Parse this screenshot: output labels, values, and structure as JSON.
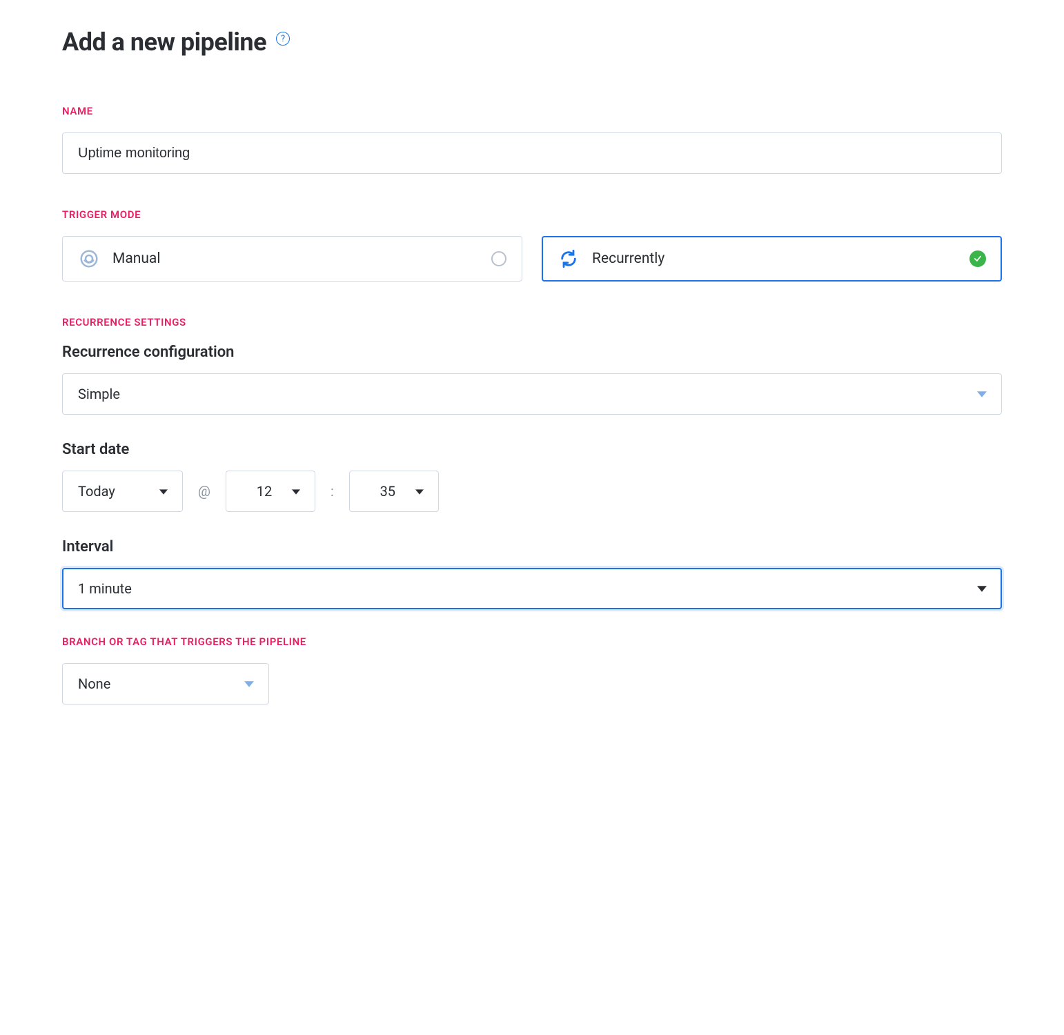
{
  "header": {
    "title": "Add a new pipeline"
  },
  "name_section": {
    "label": "NAME",
    "value": "Uptime monitoring"
  },
  "trigger_mode": {
    "label": "TRIGGER MODE",
    "options": {
      "manual": {
        "label": "Manual",
        "selected": false
      },
      "recurrently": {
        "label": "Recurrently",
        "selected": true
      }
    }
  },
  "recurrence": {
    "label": "RECURRENCE SETTINGS",
    "configuration": {
      "heading": "Recurrence configuration",
      "value": "Simple"
    },
    "start_date": {
      "heading": "Start date",
      "day": "Today",
      "at_symbol": "@",
      "hour": "12",
      "colon": ":",
      "minute": "35"
    },
    "interval": {
      "heading": "Interval",
      "value": "1 minute"
    }
  },
  "branch": {
    "label": "BRANCH OR TAG THAT TRIGGERS THE PIPELINE",
    "value": "None"
  }
}
